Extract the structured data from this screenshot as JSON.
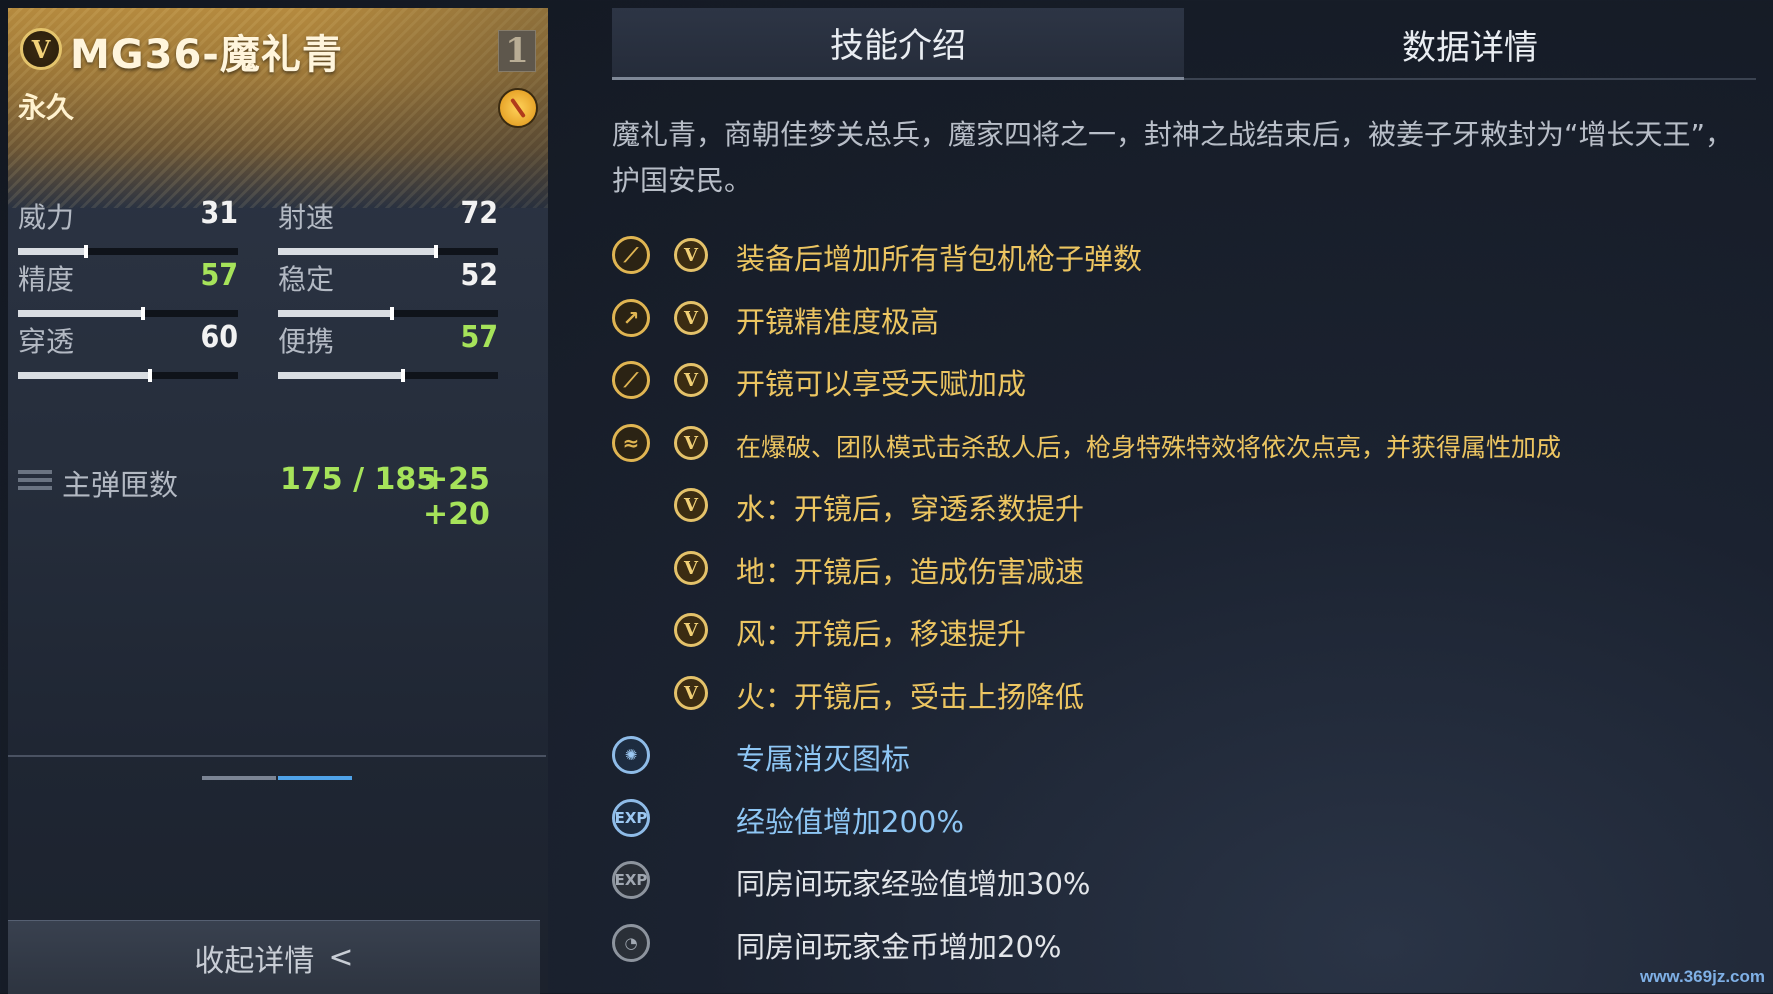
{
  "weapon": {
    "badge": "V",
    "name": "MG36-魔礼青",
    "level": "1",
    "duration": "永久"
  },
  "stats": [
    {
      "label": "威力",
      "value": 31,
      "fill": 0.31,
      "highlight": false
    },
    {
      "label": "射速",
      "value": 72,
      "fill": 0.72,
      "highlight": false
    },
    {
      "label": "精度",
      "value": 57,
      "fill": 0.57,
      "highlight": true
    },
    {
      "label": "稳定",
      "value": 52,
      "fill": 0.52,
      "highlight": false
    },
    {
      "label": "穿透",
      "value": 60,
      "fill": 0.6,
      "highlight": false
    },
    {
      "label": "便携",
      "value": 57,
      "fill": 0.57,
      "highlight": true
    }
  ],
  "ammo": {
    "label": "主弹匣数",
    "value": "175 / 185",
    "bonus": "+25 +20"
  },
  "collapse_label": "收起详情",
  "collapse_arrow": "<",
  "tabs": {
    "active": "技能介绍",
    "inactive": "数据详情"
  },
  "description": "魔礼青，商朝佳梦关总兵，魔家四将之一，封神之战结束后，被姜子牙敕封为“增长天王”，护国安民。",
  "skills": [
    {
      "icon": "crossed-guns-icon",
      "glyph": "⟋",
      "style": "gold",
      "vip": true,
      "text": "装备后增加所有背包机枪子弹数",
      "color": "gold"
    },
    {
      "icon": "scope-icon",
      "glyph": "↗",
      "style": "gold",
      "vip": true,
      "text": "开镜精准度极高",
      "color": "gold"
    },
    {
      "icon": "rifle-icon",
      "glyph": "⟋",
      "style": "gold",
      "vip": true,
      "text": "开镜可以享受天赋加成",
      "color": "gold"
    },
    {
      "icon": "wind-icon",
      "glyph": "≈",
      "style": "gold",
      "vip": true,
      "text": "在爆破、团队模式击杀敌人后，枪身特殊特效将依次点亮，并获得属性加成",
      "color": "gold",
      "small": true
    },
    {
      "icon": "",
      "vip": true,
      "text": "水：开镜后，穿透系数提升",
      "color": "gold"
    },
    {
      "icon": "",
      "vip": true,
      "text": "地：开镜后，造成伤害减速",
      "color": "gold"
    },
    {
      "icon": "",
      "vip": true,
      "text": "风：开镜后，移速提升",
      "color": "gold"
    },
    {
      "icon": "",
      "vip": true,
      "text": "火：开镜后，受击上扬降低",
      "color": "gold"
    },
    {
      "icon": "kill-icon",
      "glyph": "✺",
      "style": "blue",
      "vip": false,
      "text": "专属消灭图标",
      "color": "blue"
    },
    {
      "icon": "exp-icon",
      "glyph": "EXP",
      "style": "blue",
      "vip": false,
      "text": "经验值增加200%",
      "color": "blue"
    },
    {
      "icon": "room-exp-icon",
      "glyph": "EXP",
      "style": "grey",
      "vip": false,
      "text": "同房间玩家经验值增加30%",
      "color": "white"
    },
    {
      "icon": "room-coin-icon",
      "glyph": "◔",
      "style": "grey",
      "vip": false,
      "text": "同房间玩家金币增加20%",
      "color": "white"
    }
  ],
  "watermark": "www.369jz.com"
}
